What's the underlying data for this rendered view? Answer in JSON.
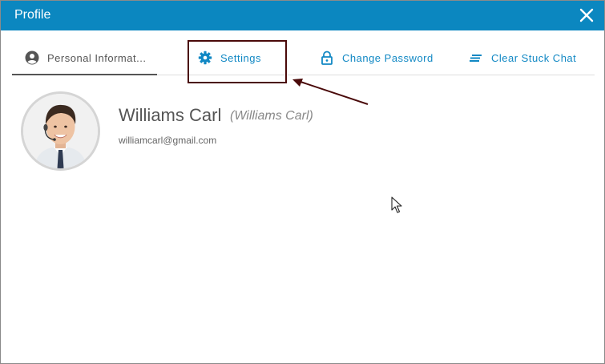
{
  "dialog": {
    "title": "Profile",
    "close_icon": "close-icon"
  },
  "tabs": [
    {
      "label": "Personal Informat...",
      "icon": "user-circle-icon",
      "active": true
    },
    {
      "label": "Settings",
      "icon": "gear-icon",
      "active": false
    },
    {
      "label": "Change Password",
      "icon": "lock-icon",
      "active": false
    },
    {
      "label": "Clear Stuck Chat",
      "icon": "list-lines-icon",
      "active": false
    }
  ],
  "profile": {
    "name": "Williams Carl",
    "alias": "(Williams Carl)",
    "email": "williamcarl@gmail.com",
    "avatar": "avatar-photo"
  },
  "colors": {
    "header": "#0b87c0",
    "tab_text": "#1188c4",
    "active_tab_text": "#555555",
    "annotation": "#4a0a0a"
  }
}
